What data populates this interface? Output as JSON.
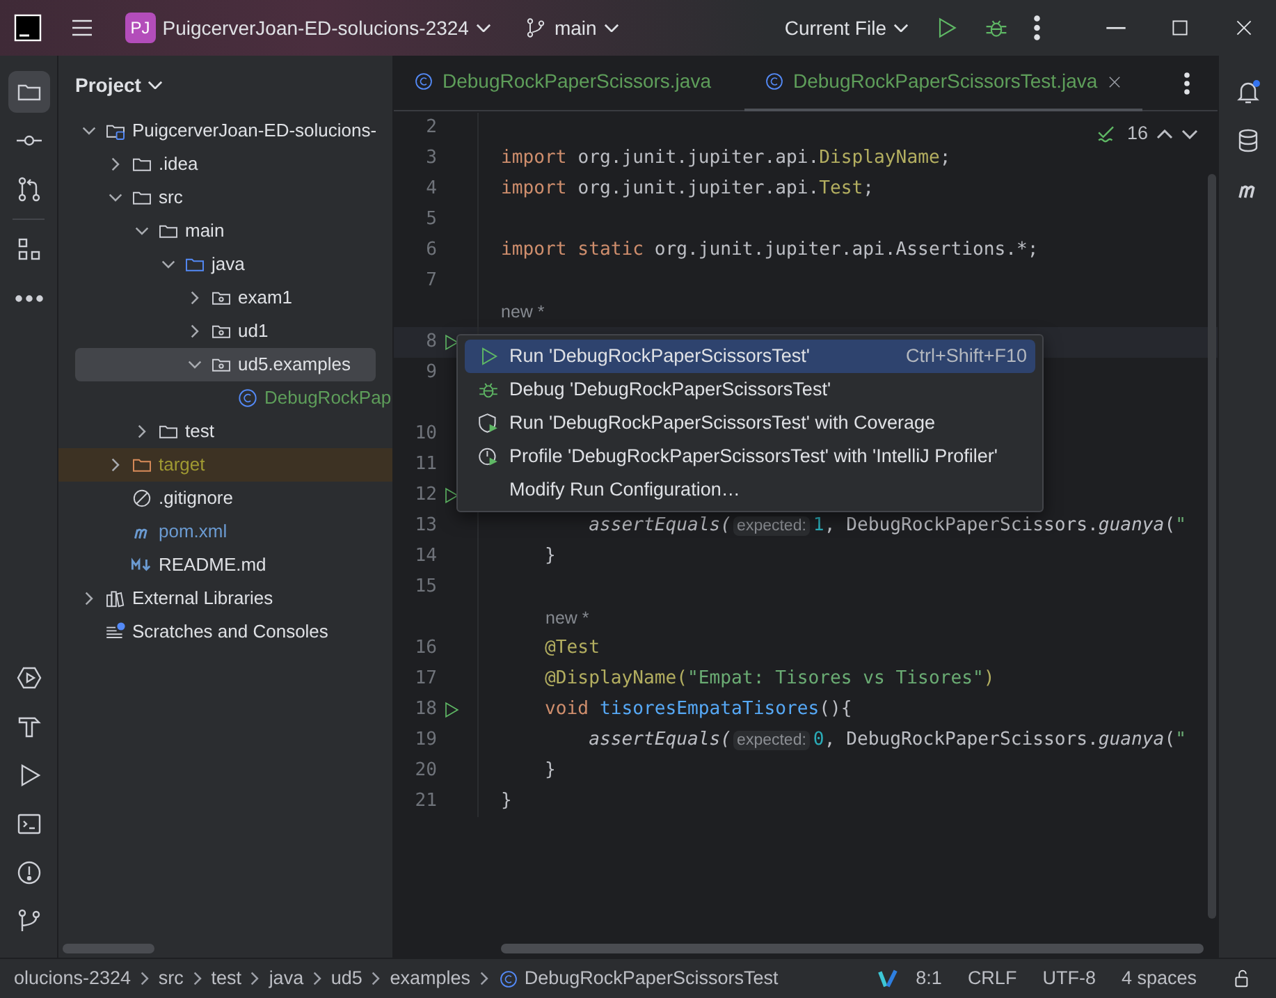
{
  "title_bar": {
    "project_badge": "PJ",
    "project_name": "PuigcerverJoan-ED-solucions-2324",
    "branch": "main",
    "run_config": "Current File"
  },
  "left_toolbar": {
    "top": [
      {
        "kind": "project",
        "selected": true
      },
      {
        "kind": "commit",
        "selected": false
      },
      {
        "kind": "pull-requests",
        "selected": false
      },
      {
        "kind": "structure",
        "selected": false
      },
      {
        "kind": "more",
        "selected": false
      }
    ],
    "bottom": [
      {
        "kind": "services"
      },
      {
        "kind": "build"
      },
      {
        "kind": "run"
      },
      {
        "kind": "terminal"
      },
      {
        "kind": "problems"
      },
      {
        "kind": "git"
      }
    ]
  },
  "project_panel": {
    "title": "Project",
    "tree": [
      {
        "kind": "module",
        "label": "PuigcerverJoan-ED-solucions-",
        "expanded": true,
        "selected": false,
        "children": [
          {
            "kind": "folder",
            "label": ".idea",
            "expanded": false,
            "selected": false
          },
          {
            "kind": "folder",
            "label": "src",
            "expanded": true,
            "selected": false,
            "children": [
              {
                "kind": "folder",
                "label": "main",
                "expanded": true,
                "selected": false,
                "children": [
                  {
                    "kind": "source-folder",
                    "label": "java",
                    "expanded": true,
                    "selected": false,
                    "children": [
                      {
                        "kind": "package",
                        "label": "exam1",
                        "expanded": false,
                        "selected": false
                      },
                      {
                        "kind": "package",
                        "label": "ud1",
                        "expanded": false,
                        "selected": false
                      },
                      {
                        "kind": "package",
                        "label": "ud5.examples",
                        "expanded": true,
                        "selected": true,
                        "children": [
                          {
                            "kind": "class",
                            "label": "DebugRockPap",
                            "selected": false,
                            "color": "#5e9e5a"
                          }
                        ]
                      }
                    ]
                  }
                ]
              },
              {
                "kind": "folder",
                "label": "test",
                "expanded": false,
                "selected": false
              }
            ]
          },
          {
            "kind": "excluded-folder",
            "label": "target",
            "expanded": false,
            "selected": false,
            "color": "#a09a32"
          },
          {
            "kind": "gitignore",
            "label": ".gitignore",
            "selected": false
          },
          {
            "kind": "maven",
            "label": "pom.xml",
            "selected": false,
            "color": "#6b9bd2"
          },
          {
            "kind": "markdown",
            "label": "README.md",
            "selected": false
          }
        ]
      },
      {
        "kind": "libraries",
        "label": "External Libraries",
        "expanded": false,
        "selected": false
      },
      {
        "kind": "scratches",
        "label": "Scratches and Consoles",
        "selected": false
      }
    ]
  },
  "editor": {
    "tabs": [
      {
        "label": "DebugRockPaperScissors.java",
        "selected": false
      },
      {
        "label": "DebugRockPaperScissorsTest.java",
        "selected": true
      }
    ],
    "problems_count": "16",
    "lines": [
      {
        "kind": "code",
        "number": "2",
        "run_marker": false,
        "current": false
      },
      {
        "kind": "code",
        "number": "3",
        "run_marker": false,
        "current": false,
        "tokens": [
          {
            "kind": "keyword",
            "text": "import"
          },
          {
            "kind": "plain",
            "text": " org.junit.jupiter.api."
          },
          {
            "kind": "annotation",
            "text": "DisplayName"
          },
          {
            "kind": "plain",
            "text": ";"
          }
        ]
      },
      {
        "kind": "code",
        "number": "4",
        "run_marker": false,
        "current": false,
        "tokens": [
          {
            "kind": "keyword",
            "text": "import"
          },
          {
            "kind": "plain",
            "text": " org.junit.jupiter.api."
          },
          {
            "kind": "annotation",
            "text": "Test"
          },
          {
            "kind": "plain",
            "text": ";"
          }
        ]
      },
      {
        "kind": "code",
        "number": "5",
        "run_marker": false,
        "current": false
      },
      {
        "kind": "code",
        "number": "6",
        "run_marker": false,
        "current": false,
        "tokens": [
          {
            "kind": "keyword",
            "text": "import static"
          },
          {
            "kind": "plain",
            "text": " org.junit.jupiter.api.Assertions.*;"
          }
        ]
      },
      {
        "kind": "code",
        "number": "7",
        "run_marker": false,
        "current": false
      },
      {
        "kind": "hint",
        "text": "new *",
        "indented": false
      },
      {
        "kind": "code",
        "number": "8",
        "run_marker": true,
        "current": true
      },
      {
        "kind": "code",
        "number": "9",
        "run_marker": false,
        "current": false
      },
      {
        "kind": "gap"
      },
      {
        "kind": "code",
        "number": "10",
        "run_marker": false,
        "current": false
      },
      {
        "kind": "code",
        "number": "11",
        "run_marker": false,
        "current": false
      },
      {
        "kind": "code",
        "number": "12",
        "run_marker": true,
        "current": false
      },
      {
        "kind": "code",
        "number": "13",
        "run_marker": false,
        "current": false,
        "tokens": [
          {
            "kind": "call",
            "text": "        assertEquals("
          },
          {
            "kind": "inlay",
            "text": "expected:"
          },
          {
            "kind": "number",
            "text": "1"
          },
          {
            "kind": "plain",
            "text": ", DebugRockPaperScissors."
          },
          {
            "kind": "call",
            "text": "guanya"
          },
          {
            "kind": "plain",
            "text": "("
          },
          {
            "kind": "string",
            "text": "\""
          }
        ]
      },
      {
        "kind": "code",
        "number": "14",
        "run_marker": false,
        "current": false,
        "tokens": [
          {
            "kind": "plain",
            "text": "    }"
          }
        ]
      },
      {
        "kind": "code",
        "number": "15",
        "run_marker": false,
        "current": false
      },
      {
        "kind": "hint",
        "text": "new *",
        "indented": true
      },
      {
        "kind": "code",
        "number": "16",
        "run_marker": false,
        "current": false,
        "tokens": [
          {
            "kind": "annotation",
            "text": "    @Test"
          }
        ]
      },
      {
        "kind": "code",
        "number": "17",
        "run_marker": false,
        "current": false,
        "tokens": [
          {
            "kind": "annotation",
            "text": "    @DisplayName("
          },
          {
            "kind": "string",
            "text": "\"Empat: Tisores vs Tisores\""
          },
          {
            "kind": "annotation",
            "text": ")"
          }
        ]
      },
      {
        "kind": "code",
        "number": "18",
        "run_marker": true,
        "current": false,
        "tokens": [
          {
            "kind": "keyword",
            "text": "    void "
          },
          {
            "kind": "method",
            "text": "tisoresEmpataTisores"
          },
          {
            "kind": "plain",
            "text": "(){"
          }
        ]
      },
      {
        "kind": "code",
        "number": "19",
        "run_marker": false,
        "current": false,
        "tokens": [
          {
            "kind": "call",
            "text": "        assertEquals("
          },
          {
            "kind": "inlay",
            "text": "expected:"
          },
          {
            "kind": "number",
            "text": "0"
          },
          {
            "kind": "plain",
            "text": ", DebugRockPaperScissors."
          },
          {
            "kind": "call",
            "text": "guanya"
          },
          {
            "kind": "plain",
            "text": "("
          },
          {
            "kind": "string",
            "text": "\""
          }
        ]
      },
      {
        "kind": "code",
        "number": "20",
        "run_marker": false,
        "current": false,
        "tokens": [
          {
            "kind": "plain",
            "text": "    }"
          }
        ]
      },
      {
        "kind": "code",
        "number": "21",
        "run_marker": false,
        "current": false,
        "tokens": [
          {
            "kind": "plain",
            "text": "}"
          }
        ]
      }
    ],
    "context_menu": {
      "items": [
        {
          "kind": "run",
          "label": "Run 'DebugRockPaperScissorsTest'",
          "shortcut": "Ctrl+Shift+F10",
          "selected": true
        },
        {
          "kind": "debug",
          "label": "Debug 'DebugRockPaperScissorsTest'",
          "selected": false
        },
        {
          "kind": "coverage",
          "label": "Run 'DebugRockPaperScissorsTest' with Coverage",
          "selected": false
        },
        {
          "kind": "profile",
          "label": "Profile 'DebugRockPaperScissorsTest' with 'IntelliJ Profiler'",
          "selected": false
        },
        {
          "kind": "plain",
          "label": "Modify Run Configuration…",
          "selected": false
        }
      ]
    }
  },
  "right_toolbar": [
    {
      "kind": "notifications"
    },
    {
      "kind": "database"
    },
    {
      "kind": "maven"
    }
  ],
  "status_bar": {
    "breadcrumbs": [
      {
        "kind": "folder",
        "label": "olucions-2324"
      },
      {
        "kind": "folder",
        "label": "src"
      },
      {
        "kind": "folder",
        "label": "test"
      },
      {
        "kind": "folder",
        "label": "java"
      },
      {
        "kind": "folder",
        "label": "ud5"
      },
      {
        "kind": "folder",
        "label": "examples"
      },
      {
        "kind": "class",
        "label": "DebugRockPaperScissorsTest"
      }
    ],
    "position": "8:1",
    "line_separator": "CRLF",
    "encoding": "UTF-8",
    "indent": "4 spaces"
  }
}
